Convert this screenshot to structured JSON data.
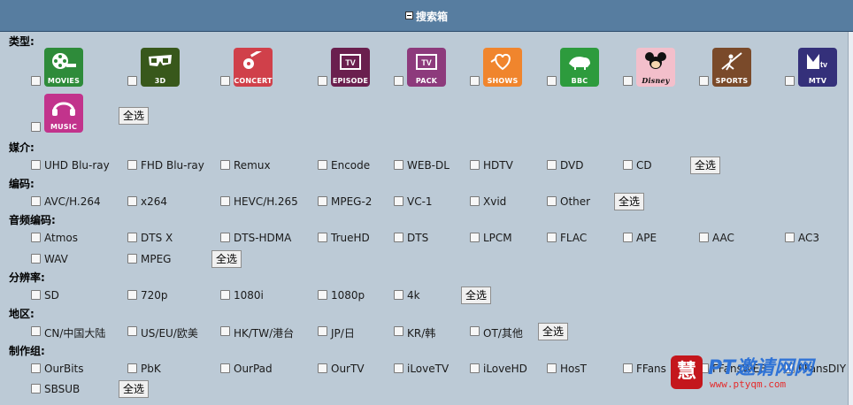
{
  "header": {
    "title": "搜索箱"
  },
  "select_all": "全选",
  "type": {
    "label": "类型:",
    "icons": [
      {
        "caption": "MOVIES",
        "color": "#2e8b3a",
        "icon": "film-reel-icon"
      },
      {
        "caption": "3D",
        "color": "#38581b",
        "icon": "3d-glasses-icon"
      },
      {
        "caption": "CONCERT",
        "color": "#d0404a",
        "icon": "guitar-icon"
      },
      {
        "caption": "EPISODE",
        "color": "#6a1f4e",
        "icon": "tv-icon"
      },
      {
        "caption": "PACK",
        "color": "#8d3a7c",
        "icon": "tv-icon"
      },
      {
        "caption": "SHOWS",
        "color": "#f0852d",
        "icon": "heart-icon"
      },
      {
        "caption": "BBC",
        "color": "#2d9b3d",
        "icon": "lion-icon"
      },
      {
        "caption": "Disney",
        "color": "#f3bfcb",
        "icon": "mickey-icon"
      },
      {
        "caption": "SPORTS",
        "color": "#7a4a2a",
        "icon": "javelin-icon"
      },
      {
        "caption": "MTV",
        "color": "#34307a",
        "icon": "mtv-logo-icon"
      },
      {
        "caption": "MUSIC",
        "color": "#c2338c",
        "icon": "headphones-icon"
      }
    ]
  },
  "media": {
    "label": "媒介:",
    "options": [
      "UHD Blu-ray",
      "FHD Blu-ray",
      "Remux",
      "Encode",
      "WEB-DL",
      "HDTV",
      "DVD",
      "CD"
    ]
  },
  "codec": {
    "label": "编码:",
    "options": [
      "AVC/H.264",
      "x264",
      "HEVC/H.265",
      "MPEG-2",
      "VC-1",
      "Xvid",
      "Other"
    ]
  },
  "audio": {
    "label": "音频编码:",
    "options": [
      "Atmos",
      "DTS X",
      "DTS-HDMA",
      "TrueHD",
      "DTS",
      "LPCM",
      "FLAC",
      "APE",
      "AAC",
      "AC3",
      "WAV",
      "MPEG"
    ]
  },
  "resolution": {
    "label": "分辨率:",
    "options": [
      "SD",
      "720p",
      "1080i",
      "1080p",
      "4k"
    ]
  },
  "region": {
    "label": "地区:",
    "options": [
      "CN/中国大陆",
      "US/EU/欧美",
      "HK/TW/港台",
      "JP/日",
      "KR/韩",
      "OT/其他"
    ]
  },
  "group": {
    "label": "制作组:",
    "options": [
      "OurBits",
      "PbK",
      "OurPad",
      "OurTV",
      "iLoveTV",
      "iLoveHD",
      "HosT",
      "FFans",
      "FFansWEB",
      "FFansDIY",
      "SBSUB"
    ]
  },
  "watermark": {
    "title": "PT邀请网网",
    "url": "www.ptyqm.com",
    "badge": "慧"
  }
}
